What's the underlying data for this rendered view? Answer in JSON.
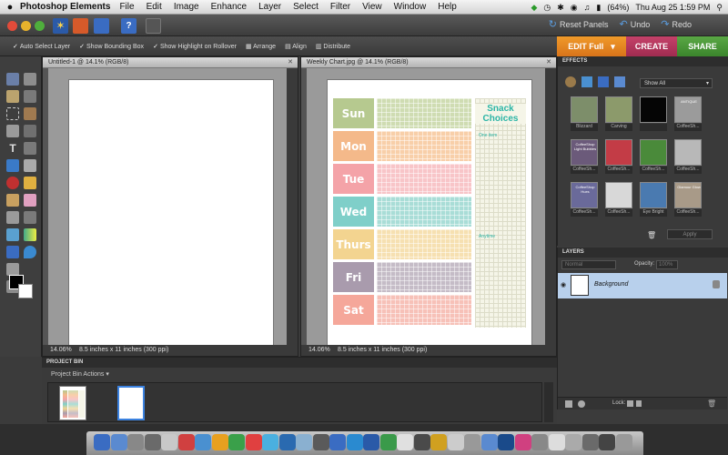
{
  "menubar": {
    "apple": "",
    "app_name": "Photoshop Elements",
    "items": [
      "File",
      "Edit",
      "Image",
      "Enhance",
      "Layer",
      "Select",
      "Filter",
      "View",
      "Window",
      "Help"
    ],
    "battery": "(64%)",
    "clock": "Thu Aug 25  1:59 PM"
  },
  "titlebar": {
    "reset_panels": "Reset Panels",
    "undo": "Undo",
    "redo": "Redo"
  },
  "options_bar": {
    "auto_select": "Auto Select Layer",
    "bounding_box": "Show Bounding Box",
    "highlight": "Show Highlight on Rollover",
    "arrange": "Arrange",
    "align": "Align",
    "distribute": "Distribute"
  },
  "modes": {
    "edit_full": "EDIT Full",
    "create": "CREATE",
    "share": "SHARE"
  },
  "doc1": {
    "title": "Untitled-1 @ 14.1% (RGB/8)",
    "zoom": "14.06%",
    "info": "8.5 inches x 11 inches (300 ppi)"
  },
  "doc2": {
    "title": "Weekly Chart.jpg @ 14.1% (RGB/8)",
    "zoom": "14.06%",
    "info": "8.5 inches x 11 inches (300 ppi)"
  },
  "chart": {
    "days": [
      "Sun",
      "Mon",
      "Tue",
      "Wed",
      "Thurs",
      "Fri",
      "Sat"
    ],
    "day_colors": [
      "#b6c98f",
      "#f4b98a",
      "#f4a3a8",
      "#7fcfc9",
      "#f3d490",
      "#a99bad",
      "#f5a79a"
    ],
    "grid_colors": [
      "#cfdcb2",
      "#f8cfa9",
      "#f8c5c8",
      "#a9ddd7",
      "#f6e0b1",
      "#c5bcc7",
      "#f7c1b8"
    ],
    "snack_title_1": "Snack",
    "snack_title_2": "Choices",
    "one_item": "One item",
    "anytime": "Anytime"
  },
  "effects": {
    "title": "EFFECTS",
    "dropdown": "Show All",
    "apply": "Apply",
    "thumbs": [
      {
        "label": "Blizzard",
        "color": "#7d8e6a"
      },
      {
        "label": "Carving",
        "color": "#8c9a6b"
      },
      {
        "label": "",
        "color": "#050505"
      },
      {
        "label": "CoffeeSh...",
        "color": "#9b9b9b"
      },
      {
        "label": "CoffeeSh...",
        "color": "#6b5a7a"
      },
      {
        "label": "CoffeeSh...",
        "color": "#c33c46"
      },
      {
        "label": "CoffeeSh...",
        "color": "#4a8a3a"
      },
      {
        "label": "CoffeeSh...",
        "color": "#b8b8b8"
      },
      {
        "label": "CoffeeSh...",
        "color": "#6a6a9a"
      },
      {
        "label": "CoffeeSh...",
        "color": "#d8d8d8"
      },
      {
        "label": "Eye Bright",
        "color": "#4a7ab0"
      },
      {
        "label": "CoffeeSh...",
        "color": "#a89a88"
      }
    ],
    "thumb_texts": [
      "",
      "",
      "",
      "ANTIQUE",
      "CoffeeShop Light Bubbles",
      "",
      "",
      "",
      "CoffeeShop Hues",
      "",
      "",
      "Glamour Glow"
    ]
  },
  "layers": {
    "title": "LAYERS",
    "blend": "Normal",
    "opacity_label": "Opacity:",
    "opacity_value": "100%",
    "layer_name": "Background",
    "lock_label": "Lock:"
  },
  "bin": {
    "title": "PROJECT BIN",
    "actions": "Project Bin Actions"
  }
}
